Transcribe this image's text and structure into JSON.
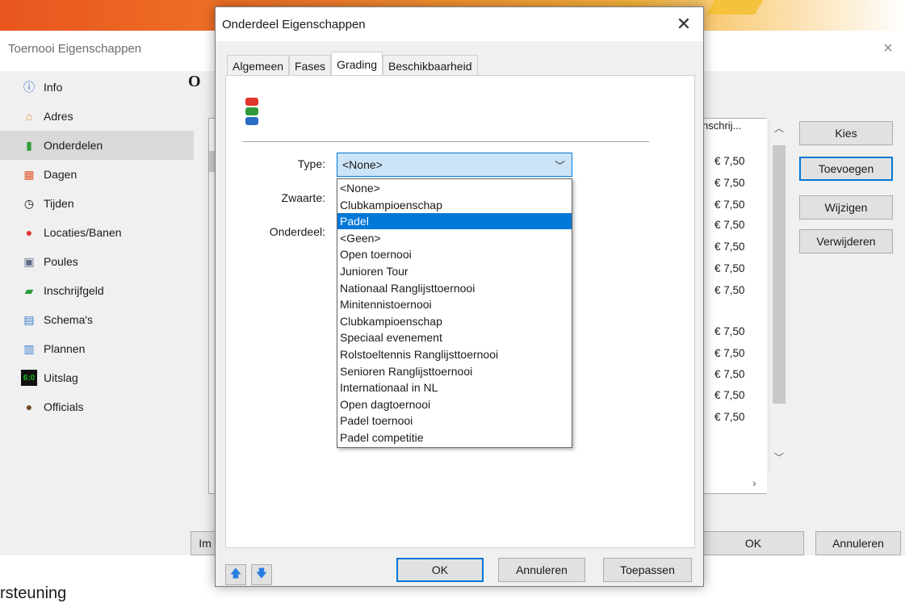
{
  "back_window": {
    "title": "Toernooi Eigenschappen",
    "close": "×",
    "heading": "O",
    "sidebar": [
      {
        "label": "Info",
        "icon": "info-icon",
        "glyph": "ⓘ",
        "color": "#2b6cc4"
      },
      {
        "label": "Adres",
        "icon": "house-icon",
        "glyph": "⌂",
        "color": "#f08a24"
      },
      {
        "label": "Onderdelen",
        "icon": "stack-icon",
        "glyph": "▮",
        "color": "#2e9a3a",
        "selected": true
      },
      {
        "label": "Dagen",
        "icon": "calendar-icon",
        "glyph": "▦",
        "color": "#e2562b"
      },
      {
        "label": "Tijden",
        "icon": "clock-icon",
        "glyph": "◷",
        "color": "#111111"
      },
      {
        "label": "Locaties/Banen",
        "icon": "map-pin-icon",
        "glyph": "●",
        "color": "#e0352a"
      },
      {
        "label": "Poules",
        "icon": "grid-icon",
        "glyph": "▣",
        "color": "#5a6b87"
      },
      {
        "label": "Inschrijfgeld",
        "icon": "money-icon",
        "glyph": "▰",
        "color": "#2d9b3b"
      },
      {
        "label": "Schema's",
        "icon": "schema-icon",
        "glyph": "▤",
        "color": "#3b7bd1"
      },
      {
        "label": "Plannen",
        "icon": "planner-icon",
        "glyph": "▥",
        "color": "#3b7bd1"
      },
      {
        "label": "Uitslag",
        "icon": "score-icon",
        "glyph": "6:0",
        "color": "#19b31f"
      },
      {
        "label": "Officials",
        "icon": "official-icon",
        "glyph": "●",
        "color": "#6b4b2a"
      }
    ],
    "price_header": "nschrij...",
    "prices": [
      "€ 7,50",
      "€ 7,50",
      "€ 7,50",
      "€ 7,50",
      "€ 7,50",
      "€ 7,50",
      "€ 7,50",
      "€ 7,50",
      "€ 7,50",
      "€ 7,50",
      "€ 7,50",
      "€ 7,50"
    ],
    "buttons": {
      "kies": "Kies",
      "toevoegen": "Toevoegen",
      "wijzigen": "Wijzigen",
      "verwijderen": "Verwijderen",
      "ok": "OK",
      "annuleren": "Annuleren",
      "im": "Im"
    },
    "bottom_text": "rsteuning"
  },
  "dialog": {
    "title": "Onderdeel Eigenschappen",
    "close": "✕",
    "tabs": [
      {
        "label": "Algemeen",
        "active": false
      },
      {
        "label": "Fases",
        "active": false
      },
      {
        "label": "Grading",
        "active": true
      },
      {
        "label": "Beschikbaarheid",
        "active": false
      }
    ],
    "labels": {
      "type": "Type:",
      "zwaarte": "Zwaarte:",
      "onderdeel": "Onderdeel:"
    },
    "type_value": "<None>",
    "options": [
      "<None>",
      "Clubkampioenschap",
      "Padel",
      "<Geen>",
      "Open toernooi",
      "Junioren Tour",
      "Nationaal Ranglijsttoernooi",
      "Minitennistoernooi",
      "Clubkampioenschap",
      "Speciaal evenement",
      "Rolstoeltennis Ranglijsttoernooi",
      "Senioren Ranglijsttoernooi",
      "Internationaal in NL",
      "Open dagtoernooi",
      "Padel toernooi",
      "Padel competitie"
    ],
    "highlighted_index": 2,
    "buttons": {
      "ok": "OK",
      "annuleren": "Annuleren",
      "toepassen": "Toepassen",
      "up": "🡅",
      "down": "🡇"
    },
    "accent": "#0078d7"
  }
}
